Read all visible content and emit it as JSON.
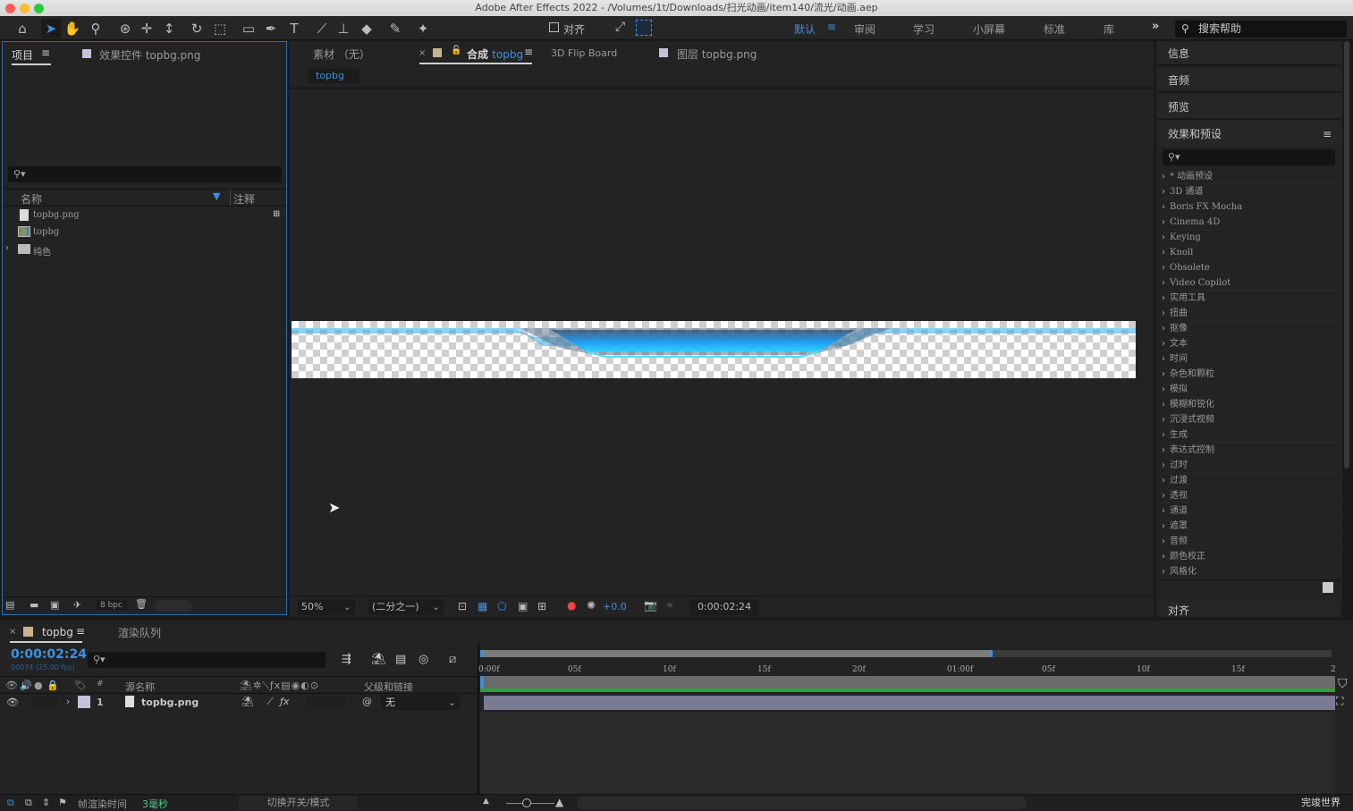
{
  "window": {
    "title": "Adobe After Effects 2022 - /Volumes/1t/Downloads/扫光动画/item140/流光/动画.aep"
  },
  "toolbar": {
    "tools": [
      {
        "name": "home-icon",
        "glyph": "⌂"
      },
      {
        "name": "selection-tool-icon",
        "glyph": "➤",
        "active": true
      },
      {
        "name": "hand-tool-icon",
        "glyph": "✋"
      },
      {
        "name": "zoom-tool-icon",
        "glyph": "⚲"
      },
      {
        "name": "orbit-camera-icon",
        "glyph": "⊛"
      },
      {
        "name": "pan-camera-icon",
        "glyph": "✛"
      },
      {
        "name": "dolly-camera-icon",
        "glyph": "↕"
      },
      {
        "name": "rotate-tool-icon",
        "glyph": "↻"
      },
      {
        "name": "anchor-point-tool-icon",
        "glyph": "⬚"
      },
      {
        "name": "rectangle-tool-icon",
        "glyph": "▭"
      },
      {
        "name": "pen-tool-icon",
        "glyph": "✒"
      },
      {
        "name": "type-tool-icon",
        "glyph": "T"
      },
      {
        "name": "brush-tool-icon",
        "glyph": "⟋"
      },
      {
        "name": "clone-stamp-tool-icon",
        "glyph": "⊥"
      },
      {
        "name": "eraser-tool-icon",
        "glyph": "◆"
      },
      {
        "name": "roto-brush-tool-icon",
        "glyph": "✎"
      },
      {
        "name": "puppet-pin-tool-icon",
        "glyph": "✦"
      }
    ],
    "align_label": "对齐",
    "workspaces": [
      "默认",
      "审阅",
      "学习",
      "小屏幕",
      "标准",
      "库"
    ],
    "active_workspace": "默认",
    "more_label": "»",
    "help_search_placeholder": "搜索帮助"
  },
  "project_panel": {
    "tabs": [
      {
        "label": "项目",
        "active": true
      },
      {
        "label": "效果控件 topbg.png",
        "active": false
      }
    ],
    "search_placeholder": "",
    "columns": {
      "name": "名称",
      "comment": "注释"
    },
    "items": [
      {
        "name": "topbg.png",
        "type": "file"
      },
      {
        "name": "topbg",
        "type": "composition"
      },
      {
        "name": "纯色",
        "type": "folder"
      }
    ],
    "bpc_label": "8 bpc"
  },
  "viewer": {
    "tabs": [
      {
        "label": "素材 （无）",
        "active": false
      },
      {
        "label_prefix": "合成",
        "label_name": "topbg",
        "active": true
      },
      {
        "label": "3D Flip Board",
        "active": false
      },
      {
        "label": "图层 topbg.png",
        "active": false
      }
    ],
    "breadcrumb": "topbg",
    "zoom": "50%",
    "resolution": "(二分之一)",
    "exposure": "+0.0",
    "timecode": "0:00:02:24",
    "colors": {
      "accent": "#3f8fe0",
      "comp_swatch": "#c7b48f",
      "layer_swatch": "#c4c0dc"
    }
  },
  "right_panel": {
    "sections": [
      "信息",
      "音频",
      "预览",
      "效果和预设"
    ],
    "effects": [
      "* 动画预设",
      "3D 通道",
      "Boris FX Mocha",
      "Cinema 4D",
      "Keying",
      "Knoll",
      "Obsolete",
      "Video Copilot",
      "实用工具",
      "扭曲",
      "抠像",
      "文本",
      "时间",
      "杂色和颗粒",
      "模拟",
      "模糊和锐化",
      "沉浸式视频",
      "生成",
      "表达式控制",
      "过时",
      "过渡",
      "透视",
      "通道",
      "遮罩",
      "音频",
      "颜色校正",
      "风格化"
    ],
    "align_section": "对齐"
  },
  "timeline": {
    "tabs": [
      {
        "label": "topbg",
        "active": true
      },
      {
        "label": "渲染队列",
        "active": false
      }
    ],
    "current_time": "0:00:02:24",
    "frame_info": "00074 (25.00 fps)",
    "columns": {
      "source_name": "源名称",
      "parent": "父级和链接",
      "number": "#"
    },
    "layers": [
      {
        "number": "1",
        "name": "topbg.png",
        "parent": "无"
      }
    ],
    "ruler": [
      "0:00f",
      "05f",
      "10f",
      "15f",
      "20f",
      "01:00f",
      "05f",
      "10f",
      "15f",
      "2"
    ],
    "work_area_fraction": 0.6,
    "colors": {
      "layer_bar": "#7b7a93",
      "work_area": "#2fa03a"
    }
  },
  "statusbar": {
    "render_time_label": "帧渲染时间",
    "render_time_value": "3毫秒",
    "toggle_label": "切换开关/模式",
    "watermark": "完竣世界"
  }
}
